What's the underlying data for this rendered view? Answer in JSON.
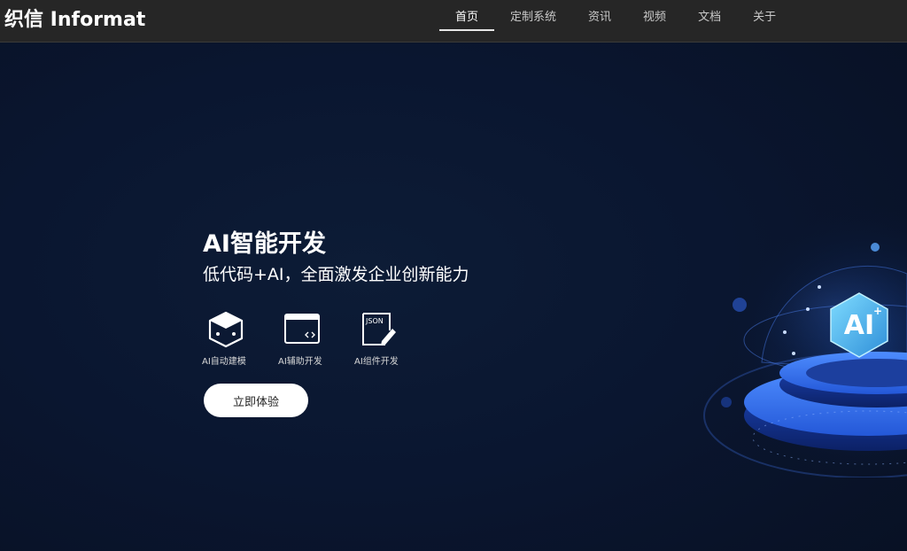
{
  "brand": {
    "name": "织信 Informat"
  },
  "nav": {
    "items": [
      {
        "label": "首页",
        "active": true
      },
      {
        "label": "定制系统",
        "active": false
      },
      {
        "label": "资讯",
        "active": false
      },
      {
        "label": "视频",
        "active": false
      },
      {
        "label": "文档",
        "active": false
      },
      {
        "label": "关于",
        "active": false
      }
    ]
  },
  "hero": {
    "title": "AI智能开发",
    "subtitle": "低代码+AI，全面激发企业创新能力",
    "features": [
      {
        "label": "AI自动建模",
        "icon": "cube-icon"
      },
      {
        "label": "AI辅助开发",
        "icon": "code-window-icon"
      },
      {
        "label": "AI组件开发",
        "icon": "json-edit-icon"
      }
    ],
    "cta_label": "立即体验",
    "illustration_text": "AI"
  },
  "colors": {
    "nav_bg": "#262626",
    "hero_bg": "#0a1428",
    "accent": "#2a7bff"
  }
}
